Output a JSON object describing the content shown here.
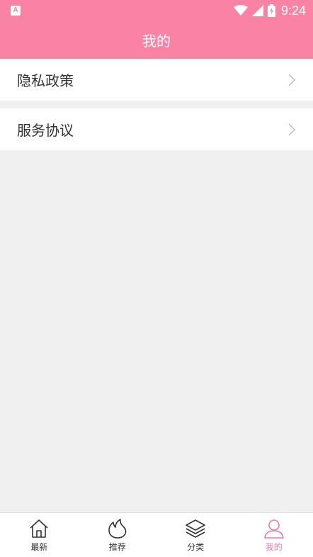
{
  "status_bar": {
    "notification_glyph": "A",
    "time": "9:24"
  },
  "header": {
    "title": "我的"
  },
  "menu": {
    "items": [
      {
        "label": "隐私政策"
      },
      {
        "label": "服务协议"
      }
    ]
  },
  "tab_bar": {
    "items": [
      {
        "label": "最新",
        "icon": "home-icon",
        "active": false
      },
      {
        "label": "推荐",
        "icon": "flame-icon",
        "active": false
      },
      {
        "label": "分类",
        "icon": "layers-icon",
        "active": false
      },
      {
        "label": "我的",
        "icon": "user-icon",
        "active": true
      }
    ]
  },
  "colors": {
    "brand": "#fa82a5",
    "active_tab": "#f07aa0",
    "background": "#f0f0f0"
  }
}
